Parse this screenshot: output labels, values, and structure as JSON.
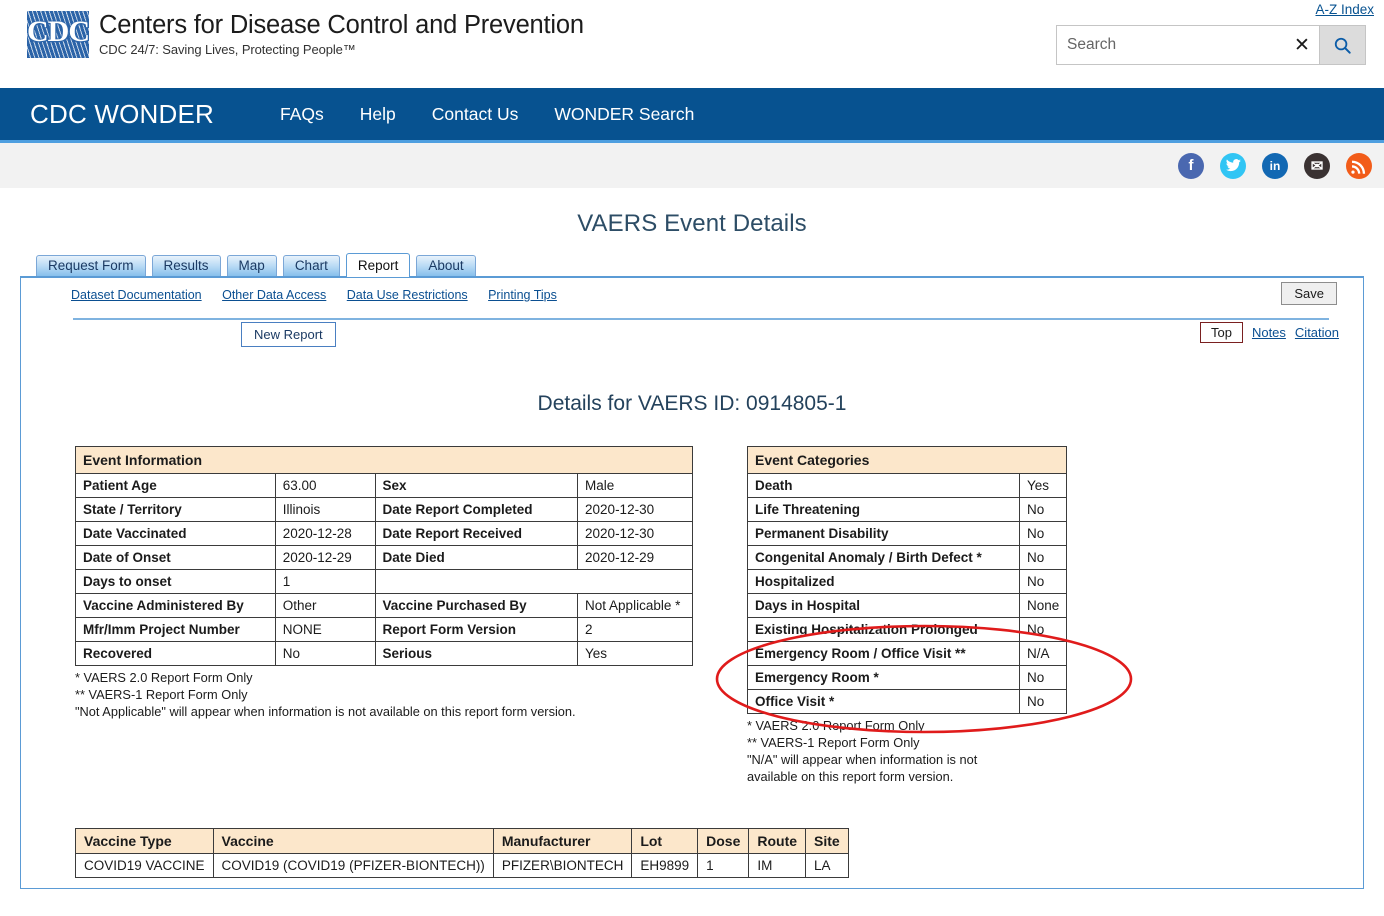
{
  "masthead": {
    "az_index": "A-Z Index",
    "logo_text": "CDC",
    "agency_name": "Centers for Disease Control and Prevention",
    "agency_tagline": "CDC 24/7: Saving Lives, Protecting People™",
    "search_placeholder": "Search",
    "search_value": "",
    "clear_glyph": "✕"
  },
  "nav": {
    "brand": "CDC WONDER",
    "items": [
      {
        "label": "FAQs"
      },
      {
        "label": "Help"
      },
      {
        "label": "Contact Us"
      },
      {
        "label": "WONDER Search"
      }
    ]
  },
  "social": [
    {
      "name": "facebook-icon",
      "glyph": "f"
    },
    {
      "name": "twitter-icon",
      "glyph": "ᵥ"
    },
    {
      "name": "linkedin-icon",
      "glyph": "in"
    },
    {
      "name": "email-icon",
      "glyph": "✉"
    },
    {
      "name": "syndicate-icon",
      "glyph": "◔"
    }
  ],
  "page": {
    "title": "VAERS Event Details",
    "details_heading": "Details for VAERS ID: 0914805-1"
  },
  "tabs": [
    {
      "label": "Request Form",
      "active": false
    },
    {
      "label": "Results",
      "active": false
    },
    {
      "label": "Map",
      "active": false
    },
    {
      "label": "Chart",
      "active": false
    },
    {
      "label": "Report",
      "active": true
    },
    {
      "label": "About",
      "active": false
    }
  ],
  "toolbar": {
    "links": [
      {
        "label": "Dataset Documentation"
      },
      {
        "label": "Other Data Access"
      },
      {
        "label": "Data Use Restrictions"
      },
      {
        "label": "Printing Tips"
      }
    ],
    "save_label": "Save",
    "new_report_label": "New Report",
    "top_label": "Top",
    "notes_label": "Notes",
    "citation_label": "Citation"
  },
  "event_information": {
    "header": "Event Information",
    "rows": [
      {
        "label1": "Patient Age",
        "value1": "63.00",
        "label2": "Sex",
        "value2": "Male"
      },
      {
        "label1": "State / Territory",
        "value1": "Illinois",
        "label2": "Date Report Completed",
        "value2": "2020-12-30"
      },
      {
        "label1": "Date Vaccinated",
        "value1": "2020-12-28",
        "label2": "Date Report Received",
        "value2": "2020-12-30"
      },
      {
        "label1": "Date of Onset",
        "value1": "2020-12-29",
        "label2": "Date Died",
        "value2": "2020-12-29"
      },
      {
        "label1": "Days to onset",
        "value1": "1",
        "label2": "",
        "value2": ""
      },
      {
        "label1": "Vaccine Administered By",
        "value1": "Other",
        "label2": "Vaccine Purchased By",
        "value2": "Not Applicable *"
      },
      {
        "label1": "Mfr/Imm Project Number",
        "value1": "NONE",
        "label2": "Report Form Version",
        "value2": "2"
      },
      {
        "label1": "Recovered",
        "value1": "No",
        "label2": "Serious",
        "value2": "Yes"
      }
    ],
    "footnote": "* VAERS 2.0 Report Form Only\n** VAERS-1 Report Form Only\n\"Not Applicable\" will appear when information is not available on this report form version."
  },
  "event_categories": {
    "header": "Event Categories",
    "rows": [
      {
        "label": "Death",
        "value": "Yes",
        "indent": false
      },
      {
        "label": "Life Threatening",
        "value": "No",
        "indent": false
      },
      {
        "label": "Permanent Disability",
        "value": "No",
        "indent": false
      },
      {
        "label": "Congenital Anomaly / Birth Defect *",
        "value": "No",
        "indent": false
      },
      {
        "label": "Hospitalized",
        "value": "No",
        "indent": false
      },
      {
        "label": "Days in Hospital",
        "value": "None",
        "indent": true
      },
      {
        "label": "Existing Hospitalization Prolonged",
        "value": "No",
        "indent": false
      },
      {
        "label": "Emergency Room / Office Visit **",
        "value": "N/A",
        "indent": false
      },
      {
        "label": "Emergency Room *",
        "value": "No",
        "indent": false
      },
      {
        "label": "Office Visit *",
        "value": "No",
        "indent": false
      }
    ],
    "footnote": "* VAERS 2.0 Report Form Only\n** VAERS-1 Report Form Only\n\"N/A\" will appear when information is not\navailable on this report form version."
  },
  "vaccine_table": {
    "columns": [
      "Vaccine Type",
      "Vaccine",
      "Manufacturer",
      "Lot",
      "Dose",
      "Route",
      "Site"
    ],
    "rows": [
      [
        "COVID19 VACCINE",
        "COVID19 (COVID19 (PFIZER-BIONTECH))",
        "PFIZER\\BIONTECH",
        "EH9899",
        "1",
        "IM",
        "LA"
      ]
    ]
  },
  "annotation": {
    "shape": "ellipse",
    "color": "#e01b1b",
    "targets": "Event Categories header, Death = Yes, Life Threatening = No"
  },
  "colors": {
    "cdc_blue": "#075290",
    "accent_blue": "#4e9fe0",
    "table_header": "#fce7cb",
    "link": "#0b4f91",
    "annotation_red": "#e01b1b"
  }
}
